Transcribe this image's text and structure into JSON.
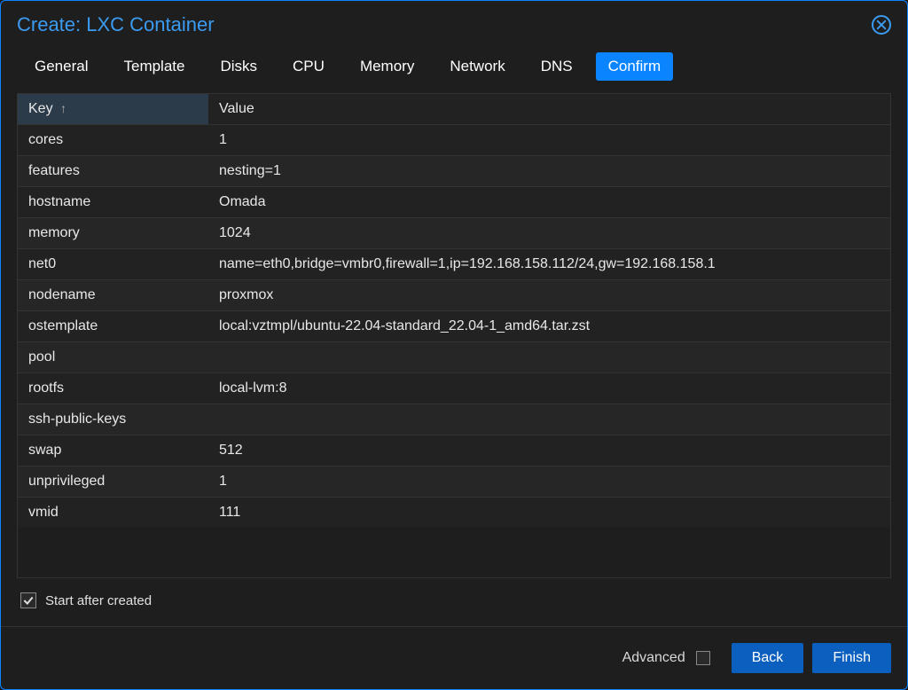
{
  "dialog": {
    "title": "Create: LXC Container"
  },
  "tabs": [
    {
      "label": "General",
      "active": false
    },
    {
      "label": "Template",
      "active": false
    },
    {
      "label": "Disks",
      "active": false
    },
    {
      "label": "CPU",
      "active": false
    },
    {
      "label": "Memory",
      "active": false
    },
    {
      "label": "Network",
      "active": false
    },
    {
      "label": "DNS",
      "active": false
    },
    {
      "label": "Confirm",
      "active": true
    }
  ],
  "table": {
    "headers": {
      "key": "Key",
      "value": "Value"
    },
    "sort_indicator": "↑",
    "rows": [
      {
        "key": "cores",
        "value": "1"
      },
      {
        "key": "features",
        "value": "nesting=1"
      },
      {
        "key": "hostname",
        "value": "Omada"
      },
      {
        "key": "memory",
        "value": "1024"
      },
      {
        "key": "net0",
        "value": "name=eth0,bridge=vmbr0,firewall=1,ip=192.168.158.112/24,gw=192.168.158.1"
      },
      {
        "key": "nodename",
        "value": "proxmox"
      },
      {
        "key": "ostemplate",
        "value": "local:vztmpl/ubuntu-22.04-standard_22.04-1_amd64.tar.zst"
      },
      {
        "key": "pool",
        "value": ""
      },
      {
        "key": "rootfs",
        "value": "local-lvm:8"
      },
      {
        "key": "ssh-public-keys",
        "value": ""
      },
      {
        "key": "swap",
        "value": "512"
      },
      {
        "key": "unprivileged",
        "value": "1"
      },
      {
        "key": "vmid",
        "value": "111"
      }
    ]
  },
  "options": {
    "start_after_created_label": "Start after created",
    "start_after_created_checked": true
  },
  "footer": {
    "advanced_label": "Advanced",
    "advanced_checked": false,
    "back_label": "Back",
    "finish_label": "Finish"
  }
}
